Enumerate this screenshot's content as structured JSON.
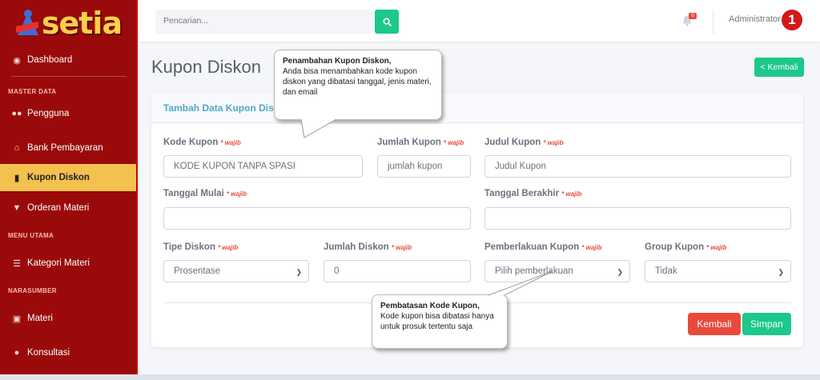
{
  "brand": {
    "name": "setia"
  },
  "sidebar": {
    "items": [
      {
        "label": "Dashboard",
        "icon": "palette-icon"
      },
      {
        "label": "Pengguna",
        "icon": "users-icon"
      },
      {
        "label": "Bank Pembayaran",
        "icon": "bank-icon"
      },
      {
        "label": "Kupon Diskon",
        "icon": "ticket-icon",
        "active": true
      },
      {
        "label": "Orderan Materi",
        "icon": "cart-icon"
      },
      {
        "label": "Kategori Materi",
        "icon": "list-icon"
      },
      {
        "label": "Materi",
        "icon": "book-icon"
      },
      {
        "label": "Konsultasi",
        "icon": "chat-icon"
      }
    ],
    "headers": [
      "MASTER DATA",
      "MENU UTAMA",
      "NARASUMBER"
    ]
  },
  "topbar": {
    "search_placeholder": "Pencarian...",
    "notif_count": "0",
    "user_name": "Administrator",
    "avatar_text": "1"
  },
  "page": {
    "title": "Kupon Diskon",
    "back_top": "< Kembali"
  },
  "card": {
    "title": "Tambah Data Kupon Diskon"
  },
  "form": {
    "required_mark": "* wajib",
    "kode_kupon": {
      "label": "Kode Kupon",
      "placeholder": "KODE KUPON TANPA SPASI"
    },
    "jumlah_kupon": {
      "label": "Jumlah Kupon",
      "placeholder": "jumlah kupon"
    },
    "judul_kupon": {
      "label": "Judul Kupon",
      "placeholder": "Judul Kupon"
    },
    "tanggal_mulai": {
      "label": "Tanggal Mulai",
      "value": ""
    },
    "tanggal_berakhir": {
      "label": "Tanggal Berakhir",
      "value": ""
    },
    "tipe_diskon": {
      "label": "Tipe Diskon",
      "value": "Prosentase"
    },
    "jumlah_diskon": {
      "label": "Jumlah Diskon",
      "value": "0"
    },
    "pemberlakuan_kupon": {
      "label": "Pemberlakuan Kupon",
      "value": "Pilih pemberlakuan"
    },
    "group_kupon": {
      "label": "Group Kupon",
      "value": "Tidak"
    },
    "kembali_label": "Kembali",
    "simpan_label": "Simpan"
  },
  "callouts": {
    "top": {
      "title": "Penambahan Kupon Diskon,",
      "body": "Anda bisa menambahkan kode kupon diskon yang dibatasi tanggal, jenis materi, dan email"
    },
    "bottom": {
      "title": "Pembatasan Kode Kupon,",
      "body": "Kode kupon bisa dibatasi hanya untuk prosuk tertentu saja"
    }
  },
  "colors": {
    "sidebar_bg": "#9a0a0a",
    "active_item": "#f2c14e",
    "accent_green": "#1cc88a",
    "danger": "#e74a3b",
    "card_title": "#4fa8c8"
  }
}
